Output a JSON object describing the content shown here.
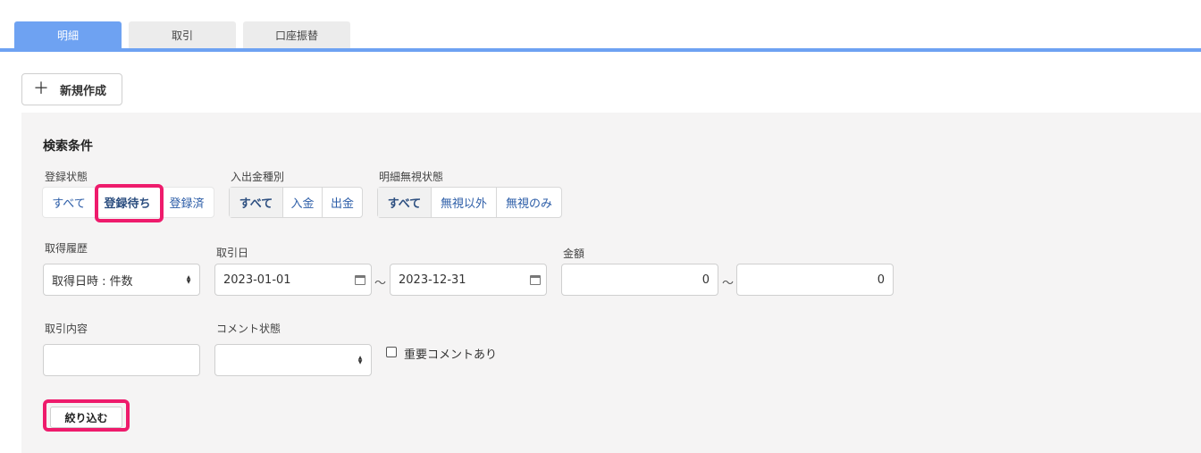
{
  "tabs": [
    {
      "label": "明細",
      "active": true
    },
    {
      "label": "取引",
      "active": false
    },
    {
      "label": "口座振替",
      "active": false
    }
  ],
  "new_button": {
    "icon": "plus-icon",
    "label": "新規作成"
  },
  "search": {
    "title": "検索条件",
    "registration_status": {
      "label": "登録状態",
      "options": [
        "すべて",
        "登録待ち",
        "登録済"
      ],
      "selected": "登録待ち"
    },
    "deposit_type": {
      "label": "入出金種別",
      "options": [
        "すべて",
        "入金",
        "出金"
      ],
      "selected": "すべて"
    },
    "ignore_status": {
      "label": "明細無視状態",
      "options": [
        "すべて",
        "無視以外",
        "無視のみ"
      ],
      "selected": "すべて"
    },
    "history": {
      "label": "取得履歴",
      "value": "取得日時 : 件数"
    },
    "date": {
      "label": "取引日",
      "from": "2023-01-01",
      "to": "2023-12-31",
      "separator": "～"
    },
    "amount": {
      "label": "金額",
      "from": "0",
      "to": "0",
      "separator": "～"
    },
    "content": {
      "label": "取引内容",
      "value": ""
    },
    "comment_status": {
      "label": "コメント状態",
      "value": ""
    },
    "important_comment": {
      "label": "重要コメントあり",
      "checked": false
    },
    "submit_label": "絞り込む"
  },
  "colors": {
    "accent": "#6ea2f2",
    "highlight": "#ee1b6c",
    "link": "#2d5ea8",
    "panel": "#f5f4f4"
  }
}
